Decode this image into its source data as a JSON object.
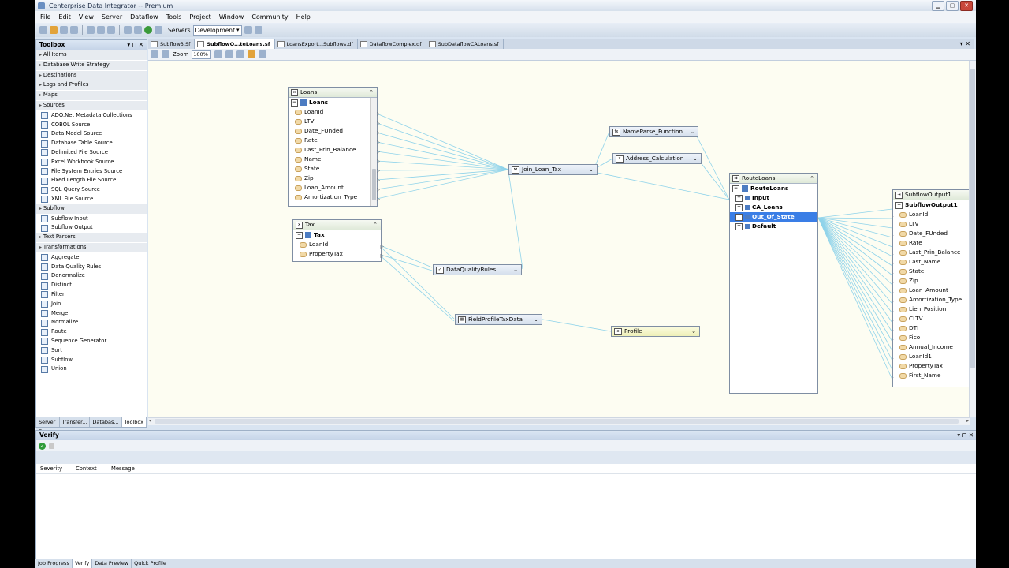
{
  "window": {
    "title": "Centerprise Data Integrator -- Premium"
  },
  "menu": [
    "File",
    "Edit",
    "View",
    "Server",
    "Dataflow",
    "Tools",
    "Project",
    "Window",
    "Community",
    "Help"
  ],
  "toolbar": {
    "servers_label": "Servers",
    "server_value": "Development"
  },
  "toolbox": {
    "title": "Toolbox",
    "items": [
      {
        "kind": "cat",
        "label": "All Items"
      },
      {
        "kind": "cat",
        "label": "Database Write Strategy"
      },
      {
        "kind": "cat",
        "label": "Destinations"
      },
      {
        "kind": "cat",
        "label": "Logs and Profiles"
      },
      {
        "kind": "cat",
        "label": "Maps"
      },
      {
        "kind": "cat",
        "label": "Sources"
      },
      {
        "kind": "item",
        "label": "ADO.Net Metadata Collections"
      },
      {
        "kind": "item",
        "label": "COBOL Source"
      },
      {
        "kind": "item",
        "label": "Data Model Source"
      },
      {
        "kind": "item",
        "label": "Database Table Source"
      },
      {
        "kind": "item",
        "label": "Delimited File Source"
      },
      {
        "kind": "item",
        "label": "Excel Workbook Source"
      },
      {
        "kind": "item",
        "label": "File System Entries Source"
      },
      {
        "kind": "item",
        "label": "Fixed Length File Source"
      },
      {
        "kind": "item",
        "label": "SQL Query Source"
      },
      {
        "kind": "item",
        "label": "XML File Source"
      },
      {
        "kind": "cat",
        "label": "Subflow"
      },
      {
        "kind": "item",
        "label": "Subflow Input"
      },
      {
        "kind": "item",
        "label": "Subflow Output"
      },
      {
        "kind": "cat",
        "label": "Text Parsers"
      },
      {
        "kind": "cat",
        "label": "Transformations"
      },
      {
        "kind": "item",
        "label": "Aggregate"
      },
      {
        "kind": "item",
        "label": "Data Quality Rules"
      },
      {
        "kind": "item",
        "label": "Denormalize"
      },
      {
        "kind": "item",
        "label": "Distinct"
      },
      {
        "kind": "item",
        "label": "Filter"
      },
      {
        "kind": "item",
        "label": "Join"
      },
      {
        "kind": "item",
        "label": "Merge"
      },
      {
        "kind": "item",
        "label": "Normalize"
      },
      {
        "kind": "item",
        "label": "Route"
      },
      {
        "kind": "item",
        "label": "Sequence Generator"
      },
      {
        "kind": "item",
        "label": "Sort"
      },
      {
        "kind": "item",
        "label": "Subflow"
      },
      {
        "kind": "item",
        "label": "Union"
      }
    ],
    "tabs": [
      "Server E...",
      "Transfer...",
      "Databas...",
      "Toolbox"
    ]
  },
  "doc_tabs": [
    "Subflow3.Sf",
    "SubflowO...teLoans.sf",
    "LoansExport...Subflows.df",
    "DataflowComplex.df",
    "SubDataflowCALoans.sf"
  ],
  "designer": {
    "zoom_label": "Zoom",
    "zoom_value": "100%"
  },
  "nodes": {
    "loans": {
      "title": "Loans",
      "root": "Loans",
      "fields": [
        "LoanId",
        "LTV",
        "Date_FUnded",
        "Rate",
        "Last_Prin_Balance",
        "Name",
        "State",
        "Zip",
        "Loan_Amount",
        "Amortization_Type"
      ]
    },
    "tax": {
      "title": "Tax",
      "root": "Tax",
      "fields": [
        "LoanId",
        "PropertyTax"
      ]
    },
    "join": {
      "title": "Join_Loan_Tax"
    },
    "nameparse": {
      "title": "NameParse_Function"
    },
    "address": {
      "title": "Address_Calculation"
    },
    "dq": {
      "title": "DataQualityRules"
    },
    "fieldprofile": {
      "title": "FieldProfileTaxData"
    },
    "profile": {
      "title": "Profile"
    },
    "route": {
      "title": "RouteLoans",
      "root": "RouteLoans",
      "groups": [
        "Input",
        "CA_Loans",
        "Out_Of_State",
        "Default"
      ]
    },
    "output": {
      "title": "SubflowOutput1",
      "root": "SubflowOutput1",
      "fields": [
        "LoanId",
        "LTV",
        "Date_FUnded",
        "Rate",
        "Last_Prin_Balance",
        "Last_Name",
        "State",
        "Zip",
        "Loan_Amount",
        "Amortization_Type",
        "Lien_Position",
        "CLTV",
        "DTI",
        "Fico",
        "Annual_Income",
        "LoanId1",
        "PropertyTax",
        "First_Name"
      ]
    }
  },
  "verify": {
    "title": "Verify",
    "columns": [
      "Severity",
      "Context",
      "Message"
    ]
  },
  "bottom_tabs": [
    "Job Progress",
    "Verify",
    "Data Preview",
    "Quick Profile"
  ]
}
